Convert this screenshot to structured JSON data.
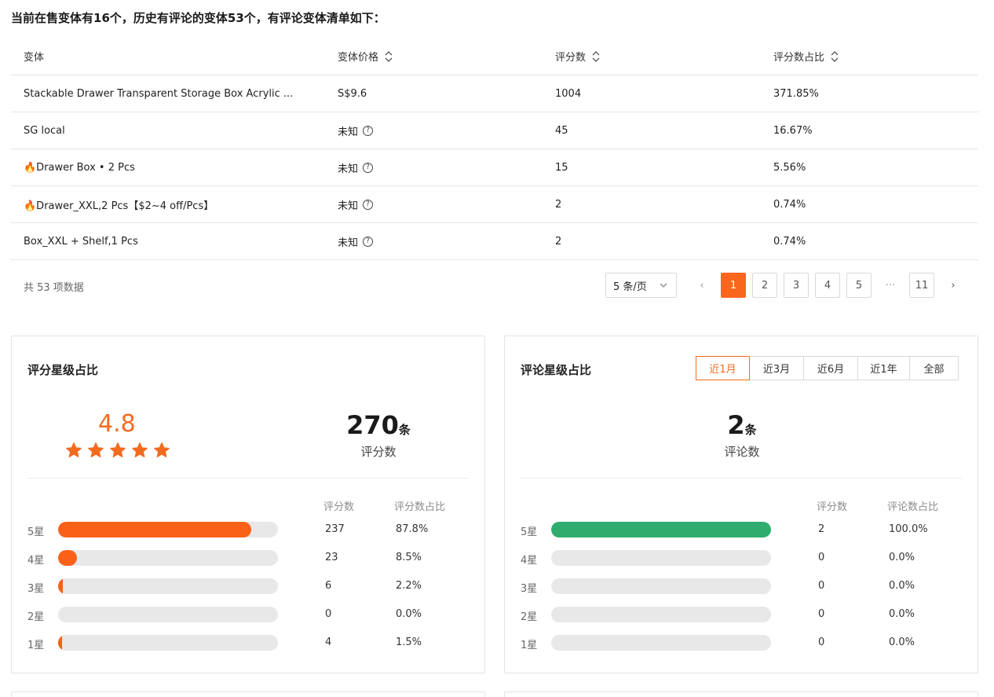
{
  "intro": "当前在售变体有16个，历史有评论的变体53个，有评论变体清单如下：",
  "table": {
    "columns": [
      "变体",
      "变体价格",
      "评分数",
      "评分数占比"
    ],
    "rows": [
      {
        "variant": "Stackable Drawer Transparent Storage Box Acrylic ...",
        "price": "S$9.6",
        "price_help": false,
        "count": "1004",
        "ratio": "371.85%"
      },
      {
        "variant": "SG local",
        "price": "未知",
        "price_help": true,
        "count": "45",
        "ratio": "16.67%"
      },
      {
        "variant": "🔥Drawer Box • 2 Pcs",
        "price": "未知",
        "price_help": true,
        "count": "15",
        "ratio": "5.56%"
      },
      {
        "variant": "🔥Drawer_XXL,2 Pcs【$2~4 off/Pcs】",
        "price": "未知",
        "price_help": true,
        "count": "2",
        "ratio": "0.74%"
      },
      {
        "variant": "Box_XXL + Shelf,1 Pcs",
        "price": "未知",
        "price_help": true,
        "count": "2",
        "ratio": "0.74%"
      }
    ],
    "help_glyph": "?"
  },
  "pagination": {
    "total": "共 53 项数据",
    "page_size": "5 条/页",
    "prev": "‹",
    "next": "›",
    "pages": [
      "1",
      "2",
      "3",
      "4",
      "5"
    ],
    "ellipsis": "···",
    "last": "11",
    "current": "1"
  },
  "rating_card": {
    "title": "评分星级占比",
    "score": "4.8",
    "stars": 5,
    "count": "270",
    "count_unit": "条",
    "count_label": "评分数",
    "col_count": "评分数",
    "col_ratio": "评分数占比",
    "bar_color": "#fa6118",
    "rows": [
      {
        "label": "5星",
        "count": "237",
        "ratio": "87.8%",
        "fraction": 0.878
      },
      {
        "label": "4星",
        "count": "23",
        "ratio": "8.5%",
        "fraction": 0.085
      },
      {
        "label": "3星",
        "count": "6",
        "ratio": "2.2%",
        "fraction": 0.022
      },
      {
        "label": "2星",
        "count": "0",
        "ratio": "0.0%",
        "fraction": 0.0
      },
      {
        "label": "1星",
        "count": "4",
        "ratio": "1.5%",
        "fraction": 0.015
      }
    ]
  },
  "review_card": {
    "title": "评论星级占比",
    "tabs": [
      "近1月",
      "近3月",
      "近6月",
      "近1年",
      "全部"
    ],
    "active_tab": "近1月",
    "count": "2",
    "count_unit": "条",
    "count_label": "评论数",
    "col_count": "评分数",
    "col_ratio": "评论数占比",
    "bar_color": "#2ead6e",
    "rows": [
      {
        "label": "5星",
        "count": "2",
        "ratio": "100.0%",
        "fraction": 1.0
      },
      {
        "label": "4星",
        "count": "0",
        "ratio": "0.0%",
        "fraction": 0.0
      },
      {
        "label": "3星",
        "count": "0",
        "ratio": "0.0%",
        "fraction": 0.0
      },
      {
        "label": "2星",
        "count": "0",
        "ratio": "0.0%",
        "fraction": 0.0
      },
      {
        "label": "1星",
        "count": "0",
        "ratio": "0.0%",
        "fraction": 0.0
      }
    ]
  },
  "colors": {
    "accent": "#f9661d",
    "star": "#f46b20",
    "green": "#2ead6e"
  }
}
